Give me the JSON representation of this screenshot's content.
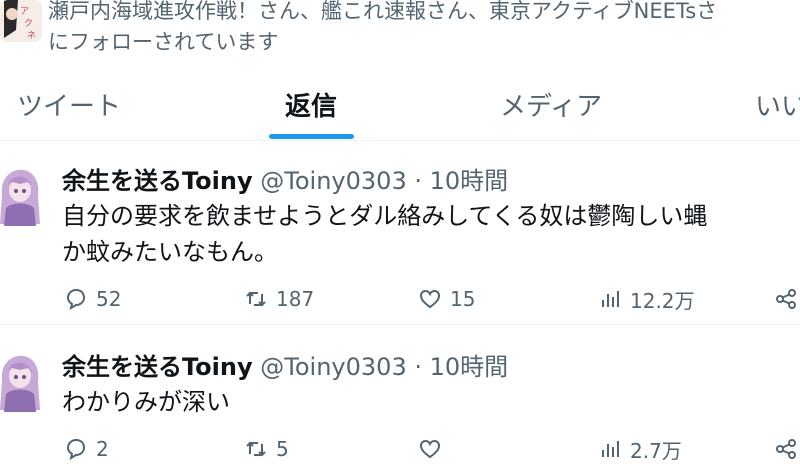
{
  "follow_banner": {
    "text_line1": "瀬戸内海域進攻作戦！さん、艦これ速報さん、東京アクティブNEETsさ",
    "text_line2": "にフォローされています"
  },
  "tabs": [
    {
      "label": "ツイート",
      "active": false
    },
    {
      "label": "返信",
      "active": true
    },
    {
      "label": "メディア",
      "active": false
    },
    {
      "label": "いいね",
      "active": false
    }
  ],
  "tweets": [
    {
      "display_name": "余生を送るToiny",
      "handle": "@Toiny0303",
      "separator": "·",
      "time": "10時間",
      "text_line1": "自分の要求を飲ませようとダル絡みしてくる奴は鬱陶しい蝿",
      "text_line2": "か蚊みたいなもん。",
      "replies": "52",
      "retweets": "187",
      "likes": "15",
      "views": "12.2万"
    },
    {
      "display_name": "余生を送るToiny",
      "handle": "@Toiny0303",
      "separator": "·",
      "time": "10時間",
      "text_line1": "わかりみが深い",
      "replies": "2",
      "retweets": "5",
      "likes": "",
      "views": "2.7万"
    }
  ],
  "colors": {
    "accent": "#1d9bf0",
    "text_primary": "#0f1419",
    "text_secondary": "#536471",
    "divider": "#eff3f4"
  }
}
